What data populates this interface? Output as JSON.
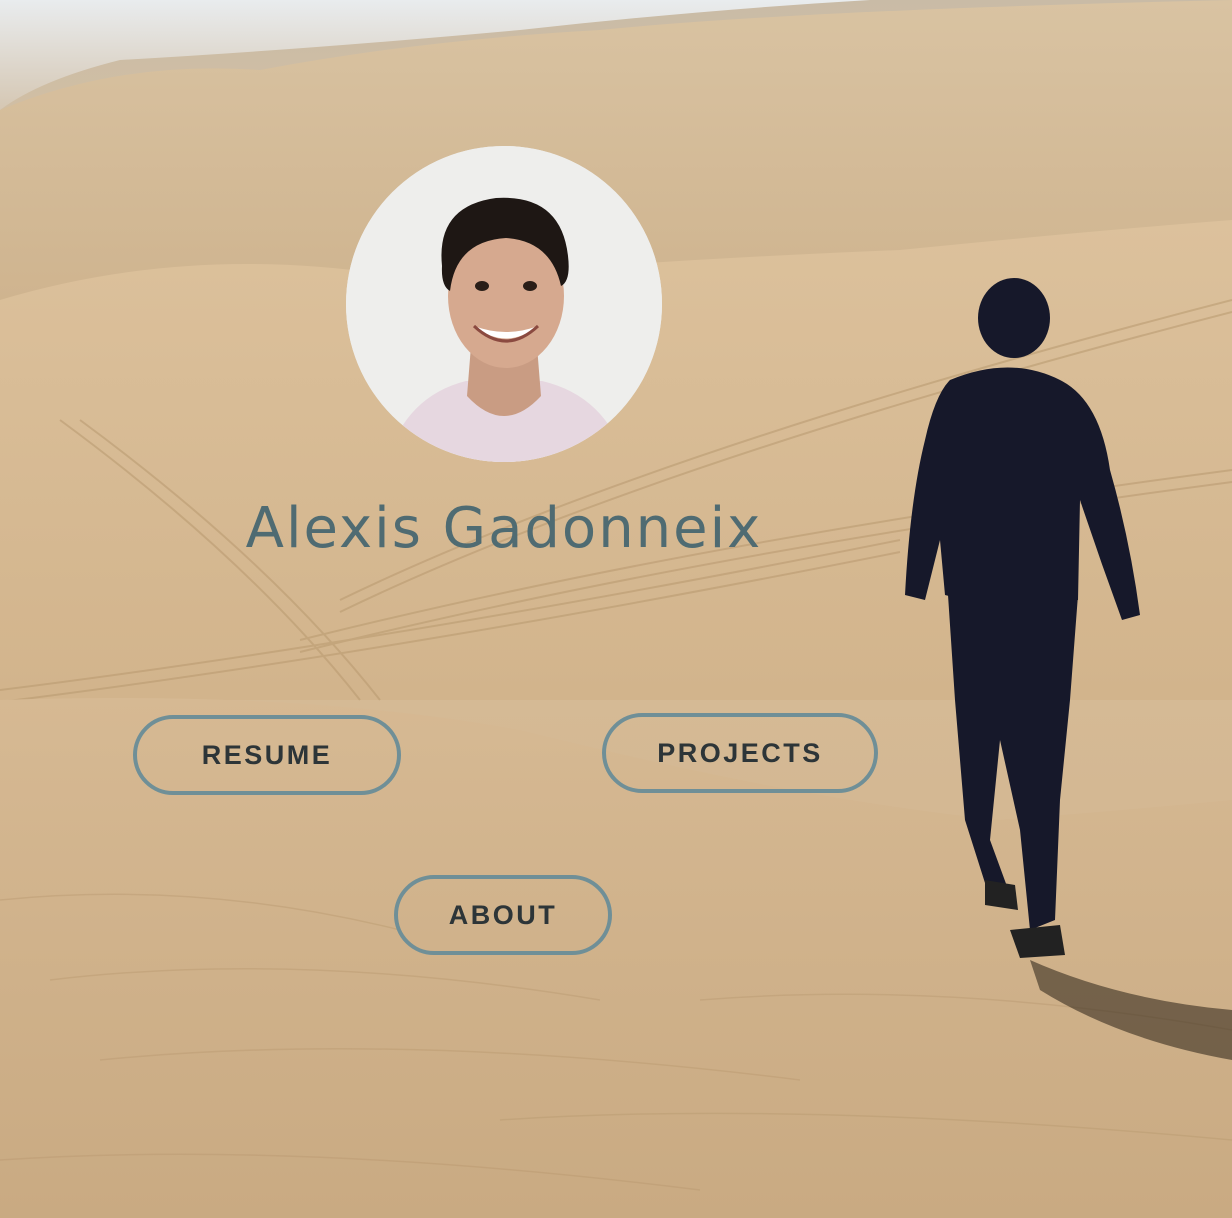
{
  "profile": {
    "name": "Alexis Gadonneix",
    "avatar_alt": "profile-photo"
  },
  "nav": {
    "resume_label": "RESUME",
    "projects_label": "PROJECTS",
    "about_label": "ABOUT"
  },
  "colors": {
    "name_text": "#4f6b72",
    "button_border": "#6f8f97",
    "button_text": "#2d3538",
    "sand": "#d8be9a"
  }
}
